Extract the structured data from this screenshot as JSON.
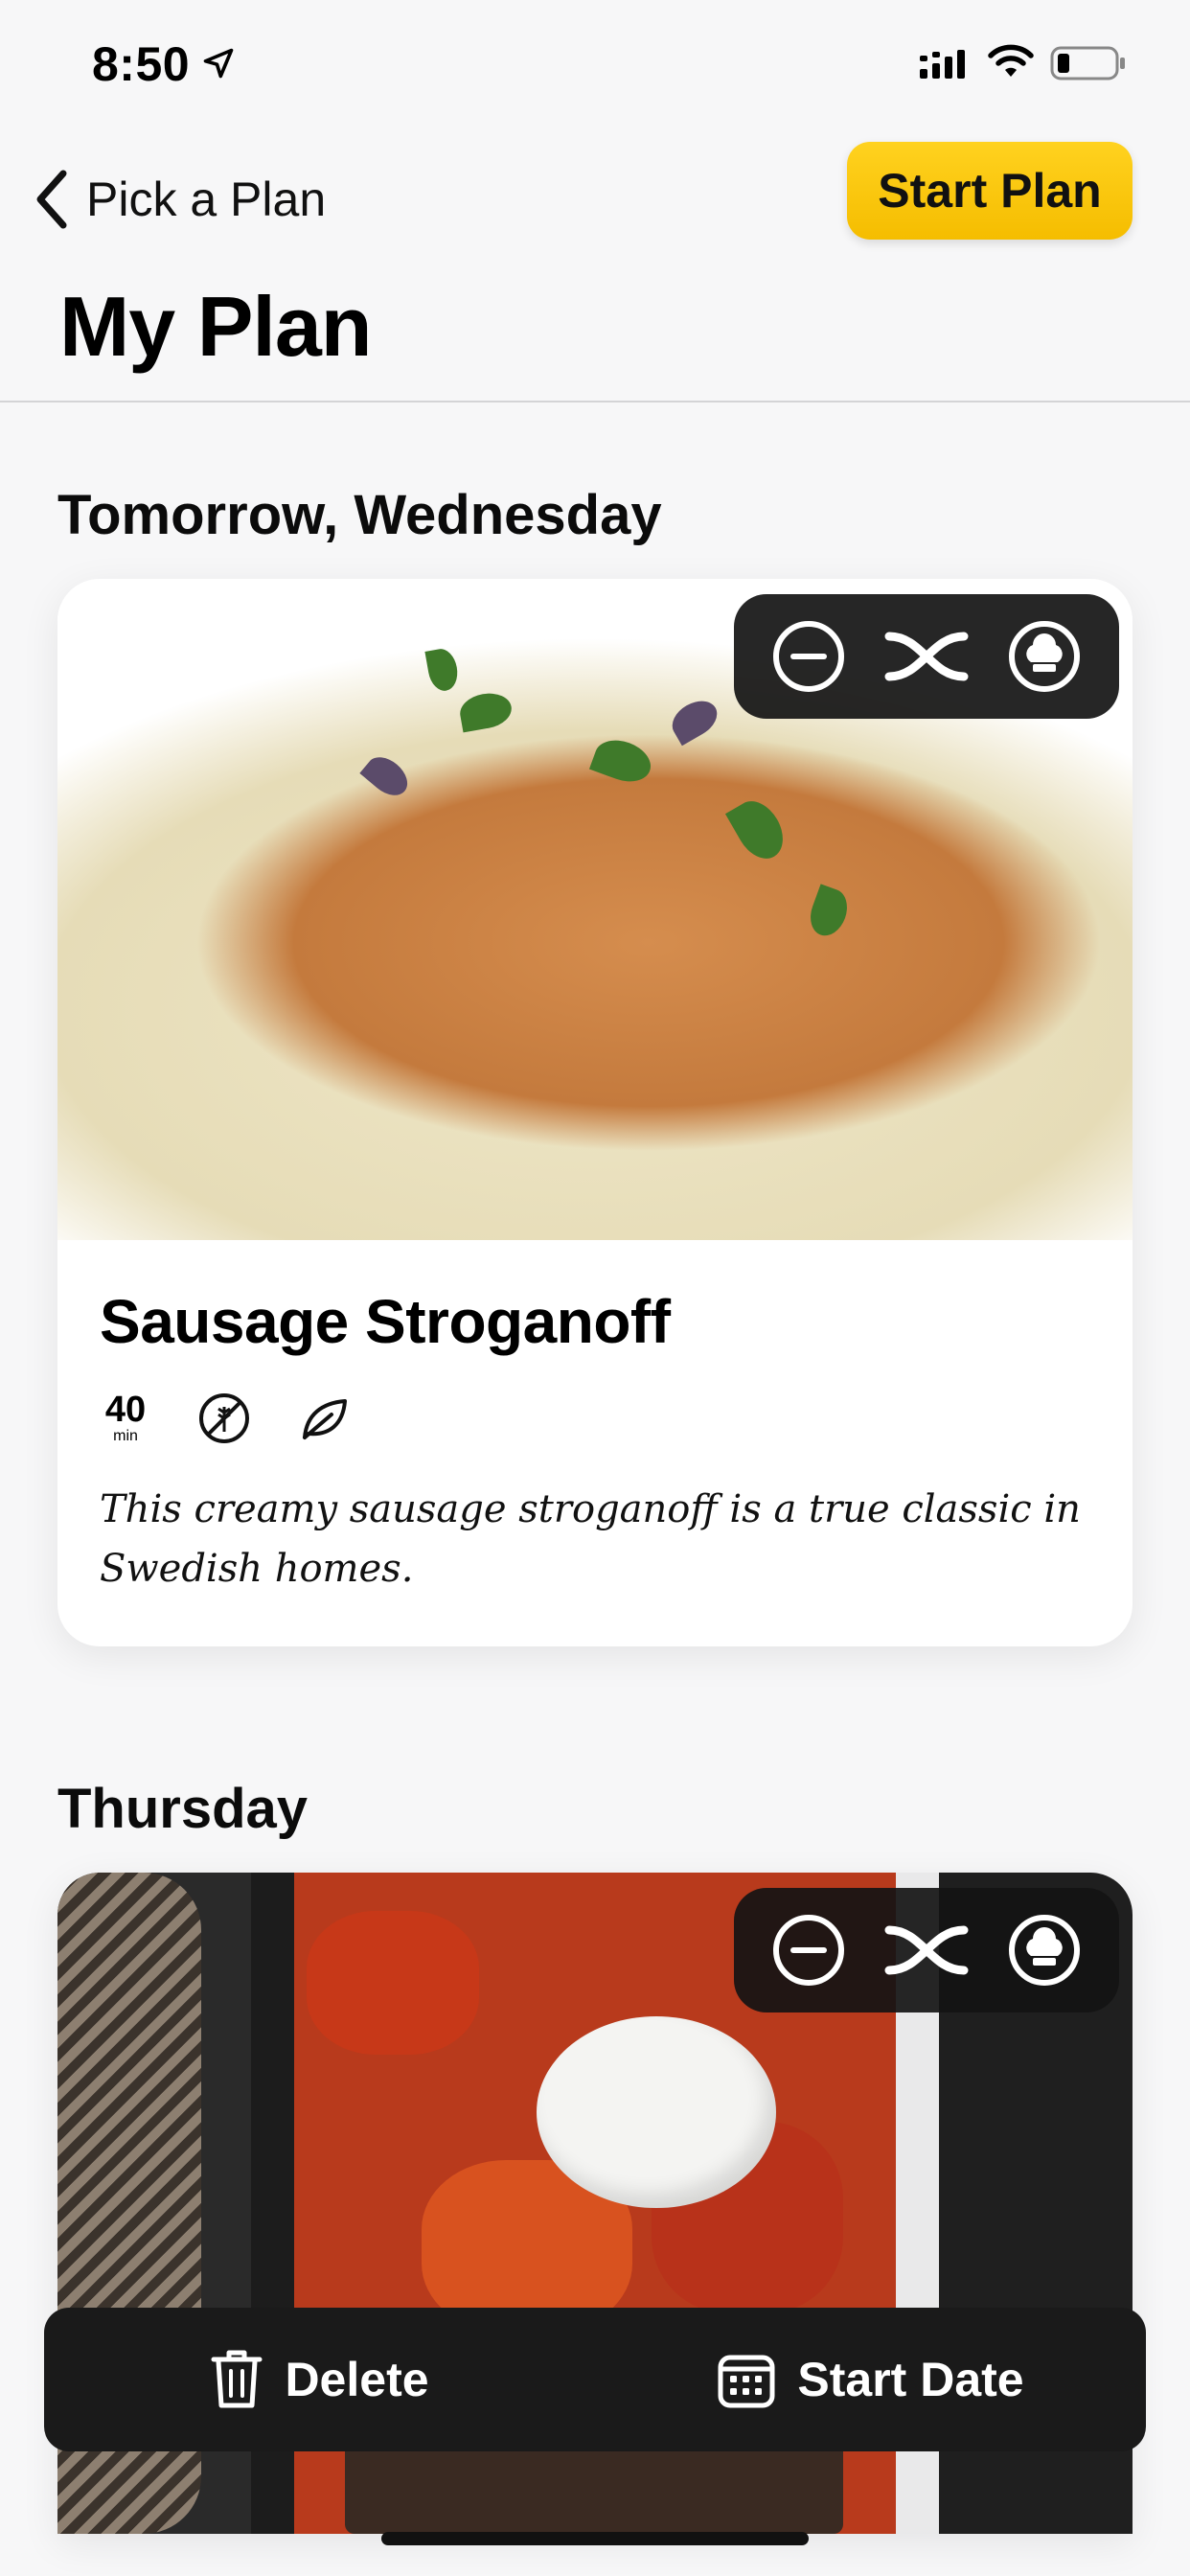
{
  "status_bar": {
    "time": "8:50"
  },
  "nav": {
    "back_label": "Pick a Plan",
    "start_plan_label": "Start Plan",
    "title": "My Plan"
  },
  "days": [
    {
      "heading": "Tomorrow, Wednesday",
      "recipe": {
        "title": "Sausage Stroganoff",
        "time_value": "40",
        "time_unit": "min",
        "description": "This creamy sausage stroganoff is a true classic in Swedish homes."
      }
    },
    {
      "heading": "Thursday"
    }
  ],
  "toolbar": {
    "delete_label": "Delete",
    "start_date_label": "Start Date"
  },
  "colors": {
    "accent": "#F5BD00",
    "toolbar_bg": "#1A1A1A"
  }
}
